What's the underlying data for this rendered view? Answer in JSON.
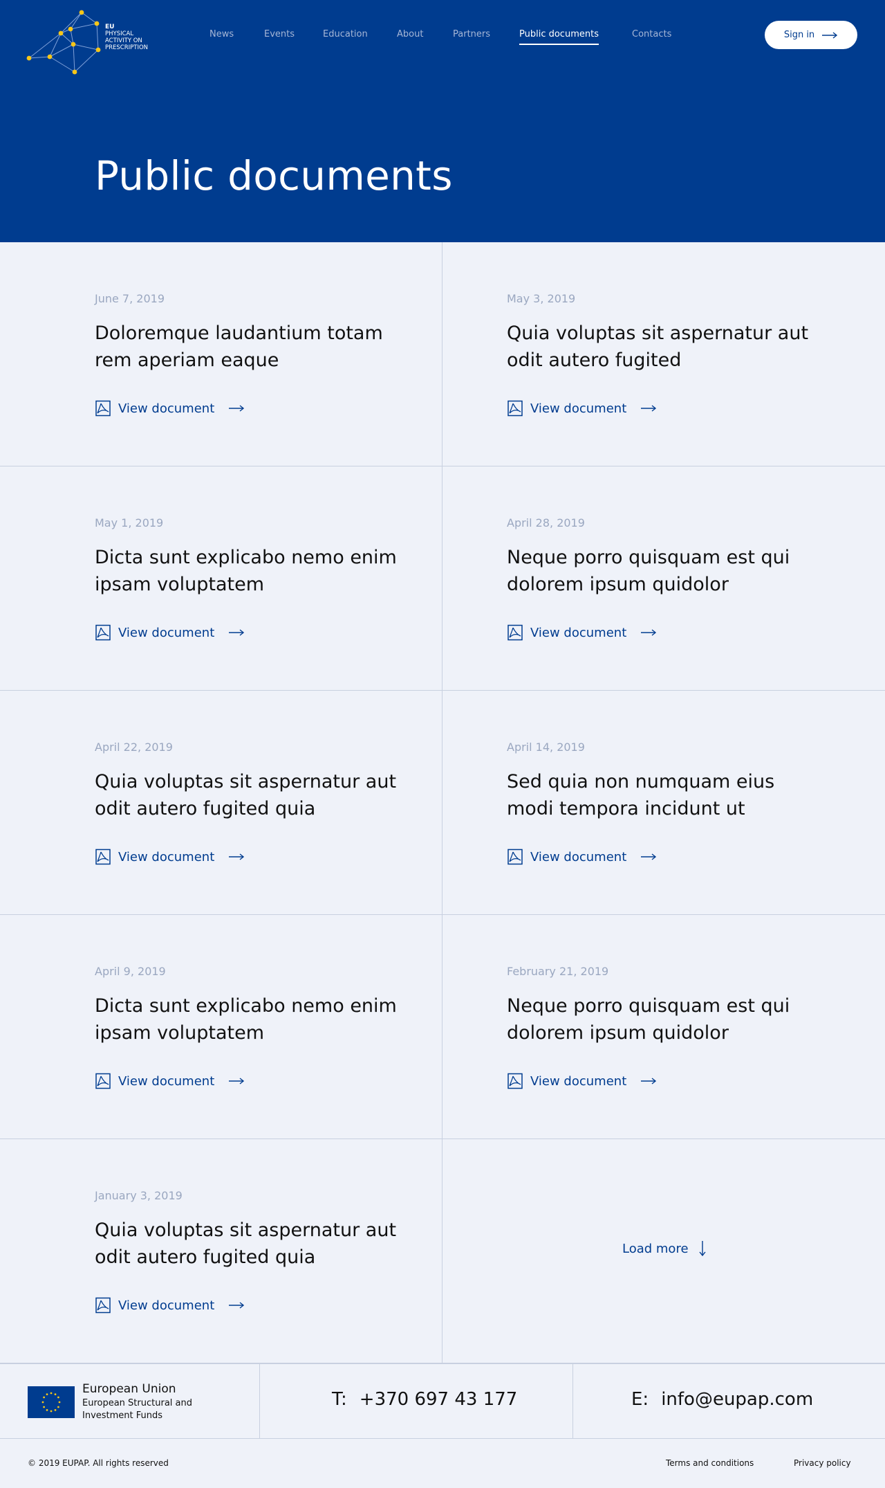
{
  "header": {
    "logo": {
      "line1": "EU",
      "line2": "PHYSICAL",
      "line3": "ACTIVITY ON",
      "line4": "PRESCRIPTION"
    },
    "nav": [
      {
        "label": "News"
      },
      {
        "label": "Events"
      },
      {
        "label": "Education"
      },
      {
        "label": "About"
      },
      {
        "label": "Partners"
      },
      {
        "label": "Public documents",
        "active": true
      },
      {
        "label": "Contacts"
      }
    ],
    "signin_label": "Sign in",
    "page_title": "Public documents"
  },
  "documents": [
    {
      "date": "June 7, 2019",
      "title": "Doloremque laudantium totam rem aperiam eaque",
      "link": "View document"
    },
    {
      "date": "May 3, 2019",
      "title": "Quia voluptas sit aspernatur aut odit autero fugited",
      "link": "View document"
    },
    {
      "date": "May 1, 2019",
      "title": "Dicta sunt explicabo nemo enim ipsam voluptatem",
      "link": "View document"
    },
    {
      "date": "April 28, 2019",
      "title": "Neque porro quisquam est qui dolorem ipsum quidolor",
      "link": "View document"
    },
    {
      "date": "April 22, 2019",
      "title": "Quia voluptas sit aspernatur aut odit autero fugited quia",
      "link": "View document"
    },
    {
      "date": "April 14, 2019",
      "title": "Sed quia non numquam eius modi tempora incidunt ut",
      "link": "View document"
    },
    {
      "date": "April 9, 2019",
      "title": "Dicta sunt explicabo nemo enim ipsam voluptatem",
      "link": "View document"
    },
    {
      "date": "February 21, 2019",
      "title": "Neque porro quisquam est qui dolorem ipsum quidolor",
      "link": "View document"
    },
    {
      "date": "January 3, 2019",
      "title": "Quia voluptas sit aspernatur aut odit autero fugited quia",
      "link": "View document"
    }
  ],
  "load_more_label": "Load more",
  "footer": {
    "eu_name": "European Union",
    "eu_sub": "European Structural and Investment Funds",
    "phone_label": "T:",
    "phone": "+370 697 43 177",
    "email_label": "E:",
    "email": "info@eupap.com",
    "copyright": "© 2019 EUPAP. All rights reserved",
    "terms": "Terms and conditions",
    "privacy": "Privacy policy"
  },
  "colors": {
    "brand_blue": "#003c8f",
    "page_bg": "#eff2f9",
    "logo_yellow": "#f6c619"
  }
}
